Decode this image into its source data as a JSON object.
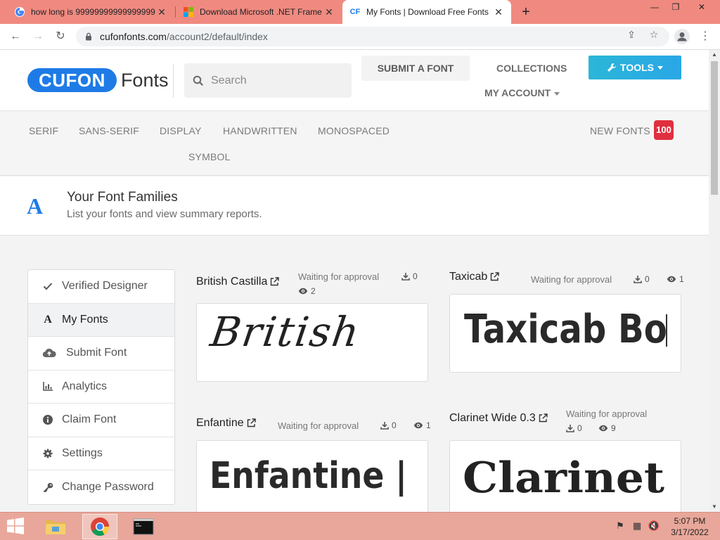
{
  "browser": {
    "tabs": [
      {
        "title": "how long is 99999999999999999",
        "favicon": "google-icon"
      },
      {
        "title": "Download Microsoft .NET Frame",
        "favicon": "microsoft-icon"
      },
      {
        "title": "My Fonts | Download Free Fonts",
        "favicon": "cufon-icon",
        "favicon_text": "CF"
      }
    ],
    "url_host": "cufonfonts.com",
    "url_path": "/account2/default/index"
  },
  "site": {
    "logo_pill": "CUFON",
    "logo_word": "Fonts",
    "search_placeholder": "Search",
    "nav": {
      "submit": "SUBMIT A FONT",
      "collections": "COLLECTIONS",
      "my_account": "MY ACCOUNT",
      "tools": "TOOLS"
    },
    "categories": [
      "SERIF",
      "SANS-SERIF",
      "DISPLAY",
      "HANDWRITTEN",
      "MONOSPACED",
      "SYMBOL"
    ],
    "new_fonts_label": "NEW FONTS",
    "new_fonts_count": "100"
  },
  "page": {
    "icon_letter": "A",
    "title": "Your Font Families",
    "subtitle": "List your fonts and view summary reports."
  },
  "sidebar": [
    {
      "label": "Verified Designer",
      "icon": "check-icon"
    },
    {
      "label": "My Fonts",
      "icon": "font-icon",
      "active": true
    },
    {
      "label": "Submit Font",
      "icon": "cloud-upload-icon"
    },
    {
      "label": "Analytics",
      "icon": "bar-chart-icon"
    },
    {
      "label": "Claim Font",
      "icon": "info-icon"
    },
    {
      "label": "Settings",
      "icon": "gear-icon"
    },
    {
      "label": "Change Password",
      "icon": "key-icon"
    }
  ],
  "fonts": [
    {
      "name": "British Castilla",
      "status": "Waiting for approval",
      "downloads": "0",
      "views": "2",
      "preview": "British"
    },
    {
      "name": "Taxicab",
      "status": "Waiting for approval",
      "downloads": "0",
      "views": "1",
      "preview": "Taxicab Bo"
    },
    {
      "name": "Enfantine",
      "status": "Waiting for approval",
      "downloads": "0",
      "views": "1",
      "preview": "Enfantine |"
    },
    {
      "name": "Clarinet Wide 0.3",
      "status": "Waiting for approval",
      "downloads": "0",
      "views": "9",
      "preview": "Clarinet"
    }
  ],
  "taskbar": {
    "time": "5:07 PM",
    "date": "3/17/2022"
  }
}
